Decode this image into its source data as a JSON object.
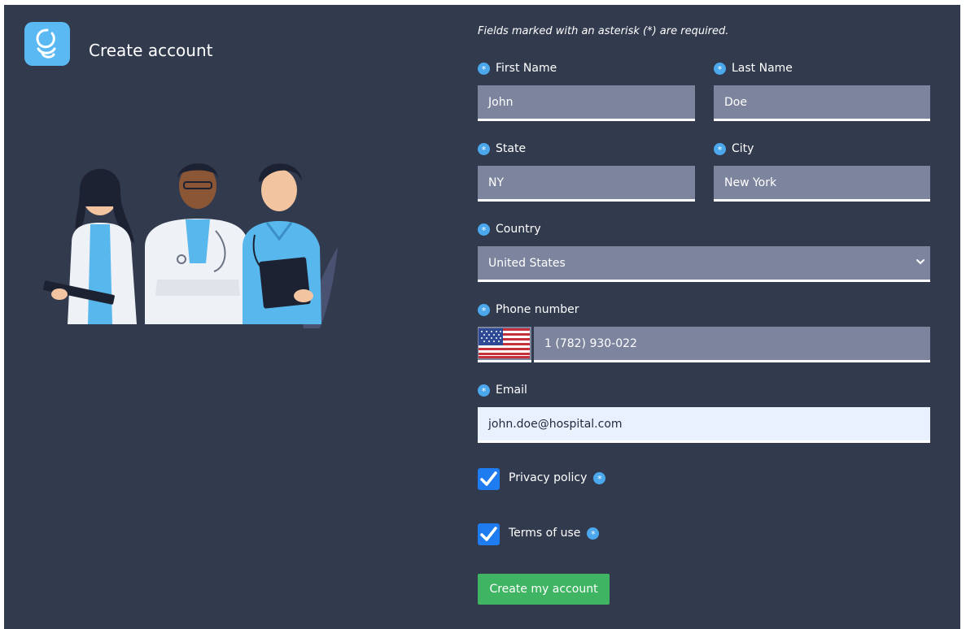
{
  "header": {
    "logo_icon": "app-logo-icon",
    "title": "Create account"
  },
  "illustration": {
    "icon": "medical-staff-illustration"
  },
  "form": {
    "required_note": "Fields marked with an asterisk (*) are required.",
    "first_name": {
      "label": "First Name",
      "value": "John"
    },
    "last_name": {
      "label": "Last Name",
      "value": "Doe"
    },
    "state": {
      "label": "State",
      "value": "NY"
    },
    "city": {
      "label": "City",
      "value": "New York"
    },
    "country": {
      "label": "Country",
      "value": "United States"
    },
    "phone": {
      "label": "Phone number",
      "value": "1 (782) 930-022",
      "flag_icon": "us-flag-icon"
    },
    "email": {
      "label": "Email",
      "value": "john.doe@hospital.com"
    },
    "privacy": {
      "label": "Privacy policy",
      "checked": true
    },
    "terms": {
      "label": "Terms of use",
      "checked": true
    },
    "submit_label": "Create my account"
  },
  "colors": {
    "background": "#323a4e",
    "field": "#7d859e",
    "accent": "#4ba8ec",
    "checkbox": "#1f7cf0",
    "submit": "#3fb563",
    "email_field": "#e9f0fe"
  }
}
